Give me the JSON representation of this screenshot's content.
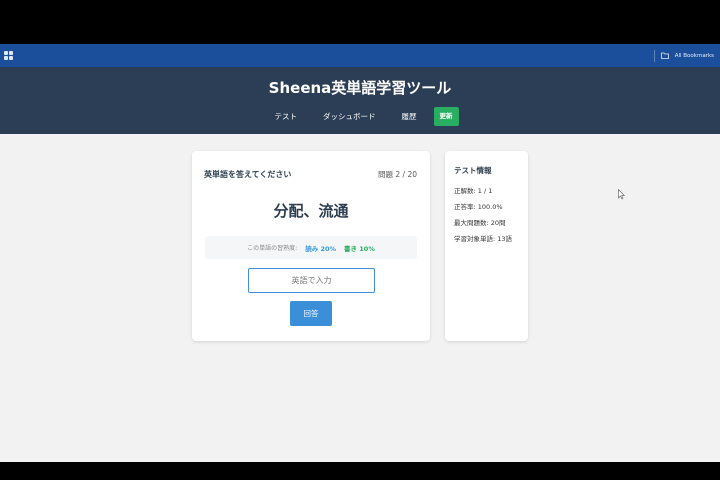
{
  "browser": {
    "bookmarks_label": "All Bookmarks"
  },
  "header": {
    "title": "Sheena英単語学習ツール",
    "nav": [
      "テスト",
      "ダッシュボード",
      "履歴"
    ],
    "update_label": "更新"
  },
  "quiz": {
    "prompt": "英単語を答えてください",
    "progress": "問題 2 / 20",
    "word": "分配、流通",
    "proficiency_label": "この単語の習熟度:",
    "reading": "読み 20%",
    "writing": "書き 10%",
    "input_placeholder": "英語で入力",
    "submit_label": "回答"
  },
  "info": {
    "title": "テスト情報",
    "rows": [
      "正解数: 1 / 1",
      "正答率: 100.0%",
      "最大問題数: 20問",
      "学習対象単語: 13語"
    ]
  },
  "colors": {
    "header_bg": "#2c3e55",
    "accent_blue": "#3a8fd8",
    "accent_green": "#27ae60",
    "bookmarks_bar": "#1b4f9c"
  }
}
